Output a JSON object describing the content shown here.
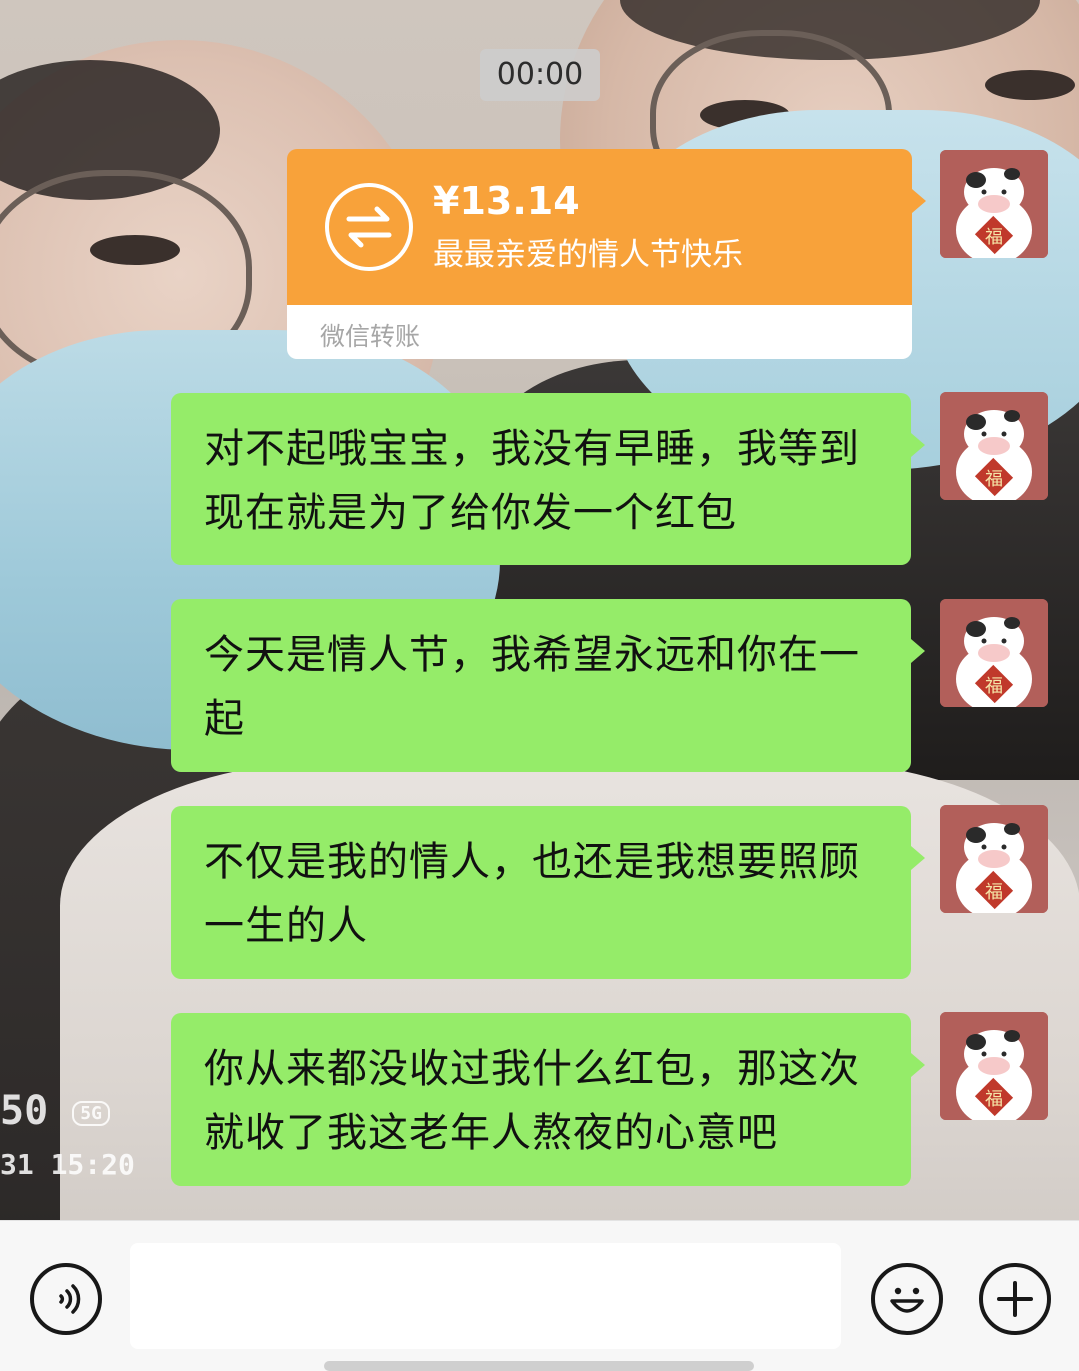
{
  "chat": {
    "timestamp": "00:00",
    "transfer": {
      "amount": "¥13.14",
      "note": "最最亲爱的情人节快乐",
      "label": "微信转账",
      "icon": "transfer-arrows-icon",
      "color": "#f8a23a"
    },
    "messages": [
      {
        "text": "对不起哦宝宝，我没有早睡，我等到现在就是为了给你发一个红包"
      },
      {
        "text": "今天是情人节，我希望永远和你在一起"
      },
      {
        "text": "不仅是我的情人，也还是我想要照顾一生的人"
      },
      {
        "text": "你从来都没收过我什么红包，那这次就收了我这老年人熬夜的心意吧"
      }
    ],
    "bubble_color": "#95ec69",
    "avatar": {
      "icon": "cartoon-cow-fu-avatar",
      "glyph": "福"
    }
  },
  "background_photo": {
    "watermark_line1": "50",
    "watermark_badge": "5G",
    "watermark_line2": "31 15:20"
  },
  "input_bar": {
    "voice_icon": "voice-icon",
    "emoji_icon": "emoji-icon",
    "plus_icon": "plus-icon",
    "input_value": ""
  }
}
